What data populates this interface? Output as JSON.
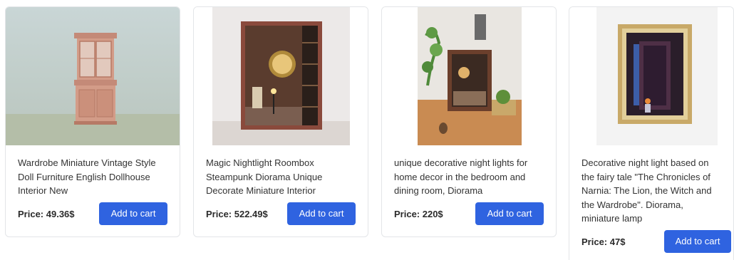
{
  "products": [
    {
      "title": "Wardrobe Miniature Vintage Style Doll Furniture English Dollhouse Interior New",
      "price": "Price: 49.36$",
      "button": "Add to cart"
    },
    {
      "title": "Magic Nightlight Roombox Steampunk Diorama Unique Decorate Miniature Interior",
      "price": "Price: 522.49$",
      "button": "Add to cart"
    },
    {
      "title": "unique decorative night lights for home decor in the bedroom and dining room, Diorama",
      "price": "Price: 220$",
      "button": "Add to cart"
    },
    {
      "title": "Decorative night light based on the fairy tale \"The Chronicles of Narnia: The Lion, the Witch and the Wardrobe\". Diorama, miniature lamp",
      "price": "Price: 47$",
      "button": "Add to cart"
    }
  ],
  "colors": {
    "button_bg": "#2f63e0",
    "button_text": "#ffffff",
    "card_border": "#e3e5e8"
  }
}
